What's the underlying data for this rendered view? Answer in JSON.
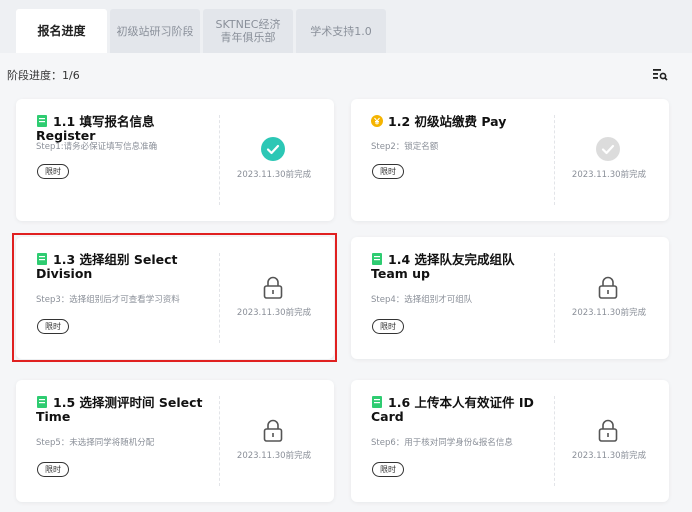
{
  "tabs": [
    {
      "label": "报名进度",
      "active": true
    },
    {
      "label": "初级站研习阶段",
      "active": false
    },
    {
      "label": "SKTNEC经济\n青年俱乐部",
      "active": false
    },
    {
      "label": "学术支持1.0",
      "active": false
    }
  ],
  "progress": {
    "text": "阶段进度：1/6"
  },
  "filter_icon": "list-search-icon",
  "tasks": [
    {
      "title": "1.1 填写报名信息 Register",
      "icon": "document-icon",
      "icon_color": "#2ecc71",
      "step": "Step1:请务必保证填写信息准确",
      "badge": "限时",
      "status": "completed",
      "date": "2023.11.30前完成"
    },
    {
      "title": "1.2 初级站缴费 Pay",
      "icon": "yen-coin-icon",
      "icon_color": "#f5b400",
      "step": "Step2：锁定名额",
      "badge": "限时",
      "status": "pending",
      "date": "2023.11.30前完成"
    },
    {
      "title": "1.3 选择组别 Select Division",
      "icon": "document-icon",
      "icon_color": "#2ecc71",
      "step": "Step3：选择组别后才可查看学习资料",
      "badge": "限时",
      "status": "locked",
      "date": "2023.11.30前完成"
    },
    {
      "title": "1.4 选择队友完成组队 Team up",
      "icon": "document-icon",
      "icon_color": "#2ecc71",
      "step": "Step4：选择组别才可组队",
      "badge": "限时",
      "status": "locked",
      "date": "2023.11.30前完成"
    },
    {
      "title": "1.5 选择测评时间 Select Time",
      "icon": "document-icon",
      "icon_color": "#2ecc71",
      "step": "Step5：未选择同学将随机分配",
      "badge": "限时",
      "status": "locked",
      "date": "2023.11.30前完成"
    },
    {
      "title": "1.6 上传本人有效证件 ID Card",
      "icon": "document-icon",
      "icon_color": "#2ecc71",
      "step": "Step6：用于核对同学身份&报名信息",
      "badge": "限时",
      "status": "locked",
      "date": "2023.11.30前完成"
    }
  ],
  "colors": {
    "completed": "#2cc7b5",
    "pending": "#dcdcdc",
    "highlight": "#e02020"
  }
}
